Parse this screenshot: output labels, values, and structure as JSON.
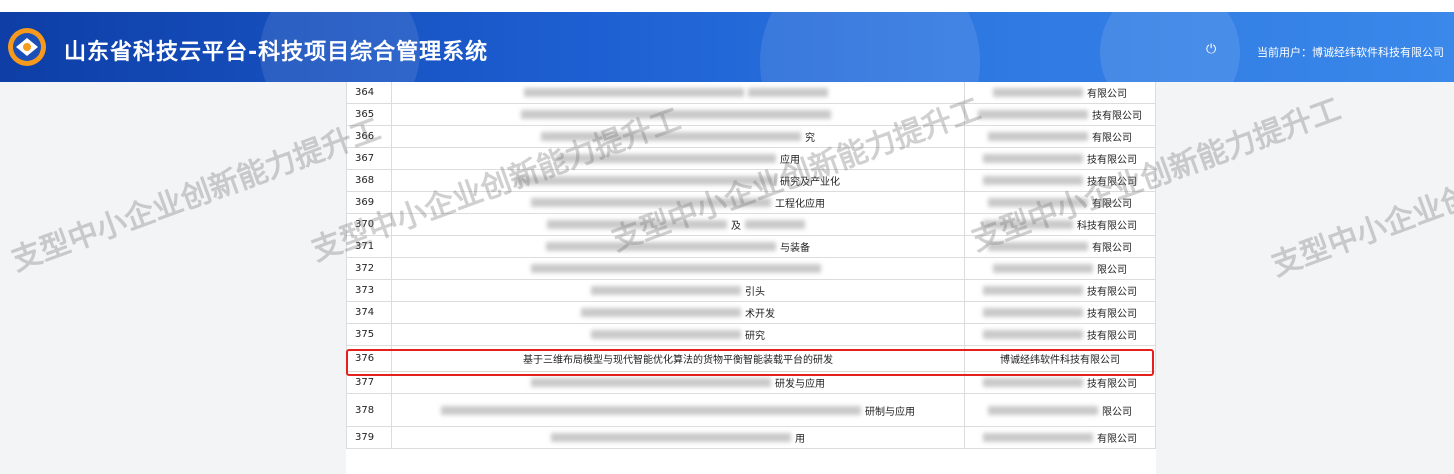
{
  "header": {
    "title": "山东省科技云平台-科技项目综合管理系统",
    "user_label": "当前用户：博诚经纬软件科技有限公司"
  },
  "table": {
    "rows": [
      {
        "num": "364",
        "name": "",
        "company": "有限公司"
      },
      {
        "num": "365",
        "name": "",
        "company": "技有限公司"
      },
      {
        "num": "366",
        "name": "究",
        "company": "有限公司"
      },
      {
        "num": "367",
        "name": "应用",
        "company": "技有限公司"
      },
      {
        "num": "368",
        "name": "研究及产业化",
        "company": "技有限公司"
      },
      {
        "num": "369",
        "name": "工程化应用",
        "company": "有限公司"
      },
      {
        "num": "370",
        "name": "及",
        "company": "科技有限公司"
      },
      {
        "num": "371",
        "name": "与装备",
        "company": "有限公司"
      },
      {
        "num": "372",
        "name": "",
        "company": "限公司"
      },
      {
        "num": "373",
        "name": "引头",
        "company": "技有限公司"
      },
      {
        "num": "374",
        "name": "术开发",
        "company": "技有限公司"
      },
      {
        "num": "375",
        "name": "研究",
        "company": "技有限公司"
      },
      {
        "num": "376",
        "name": "基于三维布局模型与现代智能优化算法的货物平衡智能装载平台的研发",
        "company": "博诚经纬软件科技有限公司"
      },
      {
        "num": "377",
        "name": "研发与应用",
        "company": "技有限公司"
      },
      {
        "num": "378",
        "name": "研制与应用",
        "company": "限公司"
      },
      {
        "num": "379",
        "name": "用",
        "company": "有限公司"
      }
    ]
  },
  "watermark": "支型中小企业创新能力提升工"
}
